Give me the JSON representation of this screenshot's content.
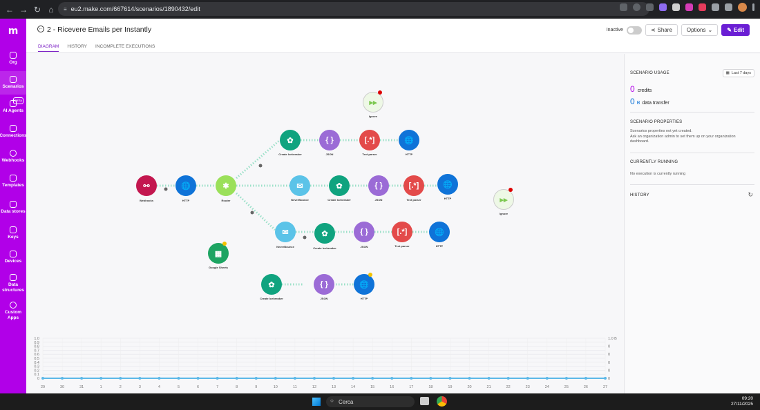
{
  "browser": {
    "url": "eu2.make.com/667614/scenarios/1890432/edit"
  },
  "sidebar": {
    "logo": "m",
    "items": [
      {
        "label": "Org",
        "icon": "home-icon"
      },
      {
        "label": "Scenarios",
        "icon": "share-icon"
      },
      {
        "label": "AI Agents",
        "icon": "agent-icon",
        "badge": "BETA"
      },
      {
        "label": "Connections",
        "icon": "link-icon"
      },
      {
        "label": "Webhooks",
        "icon": "globe-icon"
      },
      {
        "label": "Templates",
        "icon": "templates-icon"
      },
      {
        "label": "Data stores",
        "icon": "database-icon"
      },
      {
        "label": "Keys",
        "icon": "key-icon"
      },
      {
        "label": "Devices",
        "icon": "phone-icon"
      },
      {
        "label": "Data structures",
        "icon": "cube-icon"
      },
      {
        "label": "Custom Apps",
        "icon": "apps-icon"
      }
    ]
  },
  "header": {
    "title": "2 - Ricevere Emails per Instantly",
    "tabs": [
      "DIAGRAM",
      "HISTORY",
      "INCOMPLETE EXECUTIONS"
    ],
    "status": "Inactive",
    "share": "Share",
    "options": "Options",
    "edit": "Edit"
  },
  "nodes": [
    {
      "id": "webhooks",
      "label": "Webhooks",
      "color": "#c3174f"
    },
    {
      "id": "http1",
      "label": "HTTP",
      "color": "#0f73d8"
    },
    {
      "id": "router",
      "label": "Router",
      "color": "#9be05a"
    },
    {
      "id": "ignore1",
      "label": "Ignore",
      "color": "#a5e27d"
    },
    {
      "id": "ci1",
      "label": "Create Icebreaker",
      "color": "#10a37f"
    },
    {
      "id": "json1",
      "label": "JSON",
      "color": "#9b6bd6"
    },
    {
      "id": "tp1",
      "label": "Text parser",
      "color": "#e34a4a"
    },
    {
      "id": "http2",
      "label": "HTTP",
      "color": "#0f73d8"
    },
    {
      "id": "nb1",
      "label": "NeverBounce",
      "color": "#5bc3e8"
    },
    {
      "id": "ci2",
      "label": "Create Icebreaker",
      "color": "#10a37f"
    },
    {
      "id": "json2",
      "label": "JSON",
      "color": "#9b6bd6"
    },
    {
      "id": "tp2",
      "label": "Text parser",
      "color": "#e34a4a"
    },
    {
      "id": "http3",
      "label": "HTTP",
      "color": "#0f73d8"
    },
    {
      "id": "ignore2",
      "label": "Ignore",
      "color": "#a5e27d"
    },
    {
      "id": "nb2",
      "label": "NeverBounce",
      "color": "#5bc3e8"
    },
    {
      "id": "ci3",
      "label": "Create Icebreaker",
      "color": "#10a37f"
    },
    {
      "id": "json3",
      "label": "JSON",
      "color": "#9b6bd6"
    },
    {
      "id": "tp3",
      "label": "Text parser",
      "color": "#e34a4a"
    },
    {
      "id": "http4",
      "label": "HTTP",
      "color": "#0f73d8"
    },
    {
      "id": "gsheets",
      "label": "Google Sheets",
      "color": "#1da462"
    },
    {
      "id": "ci4",
      "label": "Create Icebreaker",
      "color": "#10a37f"
    },
    {
      "id": "json4",
      "label": "JSON",
      "color": "#9b6bd6"
    },
    {
      "id": "http5",
      "label": "HTTP",
      "color": "#0f73d8"
    }
  ],
  "panel": {
    "usage_title": "SCENARIO USAGE",
    "range_btn": "Last 7 days",
    "credits_value": "0",
    "credits_label": "credits",
    "transfer_value": "0",
    "transfer_unit": "B",
    "transfer_label": "data transfer",
    "props_title": "SCENARIO PROPERTIES",
    "props_text1": "Scenarios properties not yet created.",
    "props_text2": "Ask an organization admin to set them up on your organization dashboard.",
    "running_title": "CURRENTLY RUNNING",
    "running_text": "No execution is currently running",
    "history_title": "HISTORY"
  },
  "chart_data": {
    "type": "line",
    "categories": [
      "29",
      "30",
      "31",
      "1",
      "2",
      "3",
      "4",
      "5",
      "6",
      "7",
      "8",
      "9",
      "10",
      "11",
      "12",
      "13",
      "14",
      "15",
      "16",
      "17",
      "18",
      "19",
      "20",
      "21",
      "22",
      "23",
      "24",
      "25",
      "26",
      "27"
    ],
    "series": [
      {
        "values": [
          0,
          0,
          0,
          0,
          0,
          0,
          0,
          0,
          0,
          0,
          0,
          0,
          0,
          0,
          0,
          0,
          0,
          0,
          0,
          0,
          0,
          0,
          0,
          0,
          0,
          0,
          0,
          0,
          0,
          0
        ]
      }
    ],
    "ylim": [
      0,
      1.0
    ],
    "yticks_left": [
      "1.0",
      "0.9",
      "0.8",
      "0.7",
      "0.6",
      "0.5",
      "0.4",
      "0.3",
      "0.2",
      "0.1",
      "0"
    ],
    "yticks_right": [
      "1.0 B",
      "0",
      "0",
      "0",
      "0",
      "0"
    ],
    "colors": {
      "line": "#5bb8e8"
    }
  },
  "taskbar": {
    "search": "Cerca",
    "time": "09:20",
    "date": "27/11/2025"
  }
}
